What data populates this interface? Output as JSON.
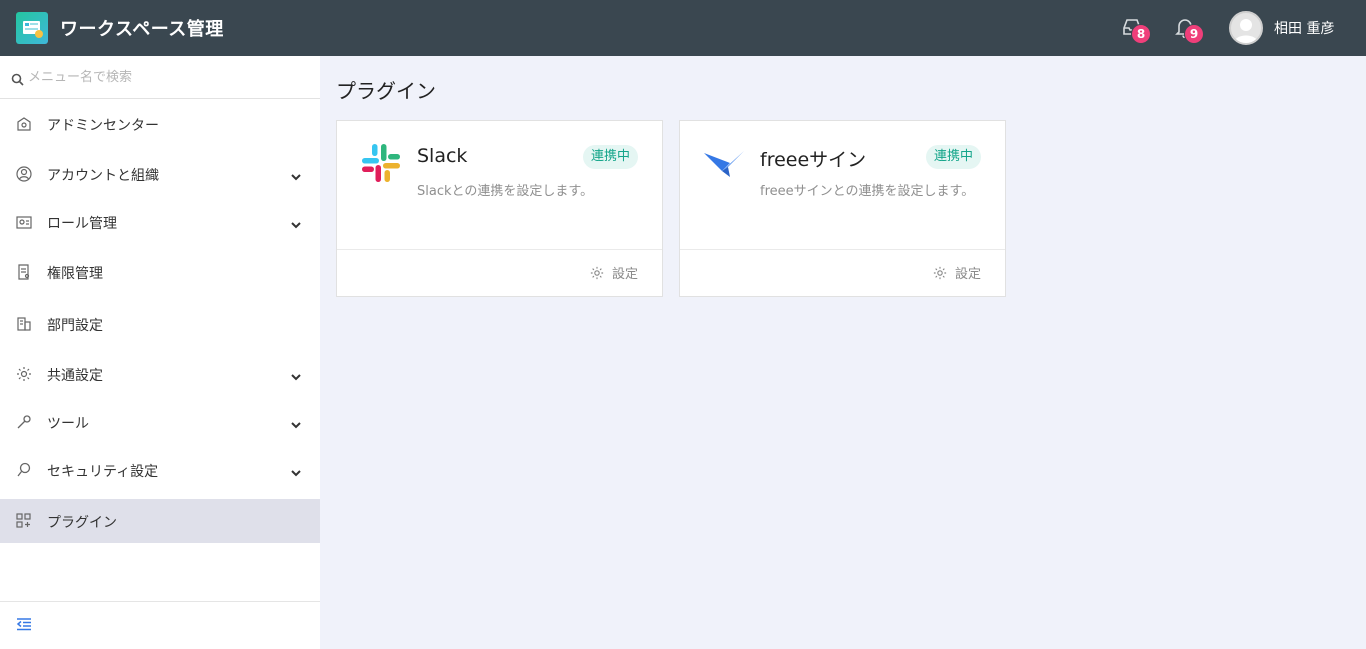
{
  "header": {
    "app_title": "ワークスペース管理",
    "inbox_count": "8",
    "notification_count": "9",
    "user_name": "相田 重彦"
  },
  "sidebar": {
    "search_placeholder": "メニュー名で検索",
    "items": [
      {
        "label": "アドミンセンター",
        "icon": "building-icon",
        "expandable": false
      },
      {
        "label": "アカウントと組織",
        "icon": "user-circle-icon",
        "expandable": true
      },
      {
        "label": "ロール管理",
        "icon": "id-card-icon",
        "expandable": true
      },
      {
        "label": "権限管理",
        "icon": "document-key-icon",
        "expandable": false
      },
      {
        "label": "部門設定",
        "icon": "office-icon",
        "expandable": false
      },
      {
        "label": "共通設定",
        "icon": "gear-icon",
        "expandable": true
      },
      {
        "label": "ツール",
        "icon": "wrench-icon",
        "expandable": true
      },
      {
        "label": "セキュリティ設定",
        "icon": "magnifier-icon",
        "expandable": true
      },
      {
        "label": "プラグイン",
        "icon": "plugin-grid-icon",
        "expandable": false,
        "active": true
      }
    ]
  },
  "main": {
    "title": "プラグイン",
    "cards": [
      {
        "name": "Slack",
        "status": "連携中",
        "description": "Slackとの連携を設定します。",
        "settings_label": "設定",
        "icon": "slack-logo-icon"
      },
      {
        "name": "freeeサイン",
        "status": "連携中",
        "description": "freeeサインとの連携を設定します。",
        "settings_label": "設定",
        "icon": "freee-sign-logo-icon"
      }
    ]
  },
  "colors": {
    "header_bg": "#3a4750",
    "badge": "#ef3f7a",
    "status_text": "#14a58a",
    "status_bg": "#e5f6f3",
    "active_nav_bg": "#dfe0ea",
    "main_bg": "#f0f2fa",
    "accent_blue": "#3578e5"
  }
}
